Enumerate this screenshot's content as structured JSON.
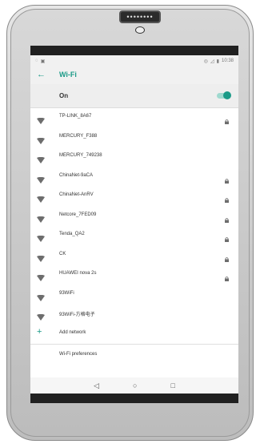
{
  "status_bar": {
    "time": "10:38"
  },
  "app_bar": {
    "title": "Wi-Fi"
  },
  "wifi_toggle": {
    "label": "On",
    "state": "on"
  },
  "networks": [
    {
      "name": "TP-LINK_8A67",
      "locked": true
    },
    {
      "name": "MERCURY_F388",
      "locked": false
    },
    {
      "name": "MERCURY_749238",
      "locked": false
    },
    {
      "name": "ChinaNet-9aCA",
      "locked": true
    },
    {
      "name": "ChinaNet-AnRV",
      "locked": true
    },
    {
      "name": "Netcore_7FED09",
      "locked": true
    },
    {
      "name": "Tenda_QA2",
      "locked": true
    },
    {
      "name": "CK",
      "locked": true
    },
    {
      "name": "HUAWEI nova 2s",
      "locked": true
    },
    {
      "name": "93WiFi",
      "locked": false
    },
    {
      "name": "93WiFi-方格电子",
      "locked": false
    }
  ],
  "add_network": {
    "label": "Add network"
  },
  "preferences": {
    "label": "Wi-Fi preferences"
  },
  "nav": {
    "back": "◁",
    "home": "○",
    "recents": "□"
  },
  "colors": {
    "accent": "#1a9a87",
    "toggle_track": "#9fd9cf"
  },
  "icons": {
    "wifi": "wifi-icon",
    "lock": "lock-icon",
    "back": "arrow-back-icon",
    "add": "plus-icon"
  }
}
